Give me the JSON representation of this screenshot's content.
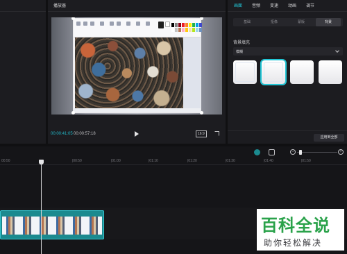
{
  "player": {
    "title": "播放器",
    "current_time": "00:00:41:05",
    "duration": "00:00:57:18",
    "aspect_ratio": "16:9"
  },
  "properties": {
    "tabs": [
      "画面",
      "音频",
      "变速",
      "动画",
      "调节"
    ],
    "active_tab": "画面",
    "subtabs": [
      "基础",
      "抠像",
      "蒙版",
      "背景"
    ],
    "active_subtab": "背景",
    "section_title": "背景填充",
    "fill_select_value": "模糊",
    "apply_all_label": "应用到全部"
  },
  "timeline": {
    "ruler_ticks": [
      "00:50",
      "|00:50",
      "|01:00",
      "|01:10",
      "|01:20",
      "|01:30",
      "|01:40",
      "|01:50"
    ]
  },
  "watermark": {
    "main": "百科全说",
    "sub": "助你轻松解决"
  },
  "colors": {
    "accent": "#22c6d6",
    "clip": "#1b8a8f",
    "panel": "#1c1c20",
    "watermark_green": "#2aa24a"
  }
}
